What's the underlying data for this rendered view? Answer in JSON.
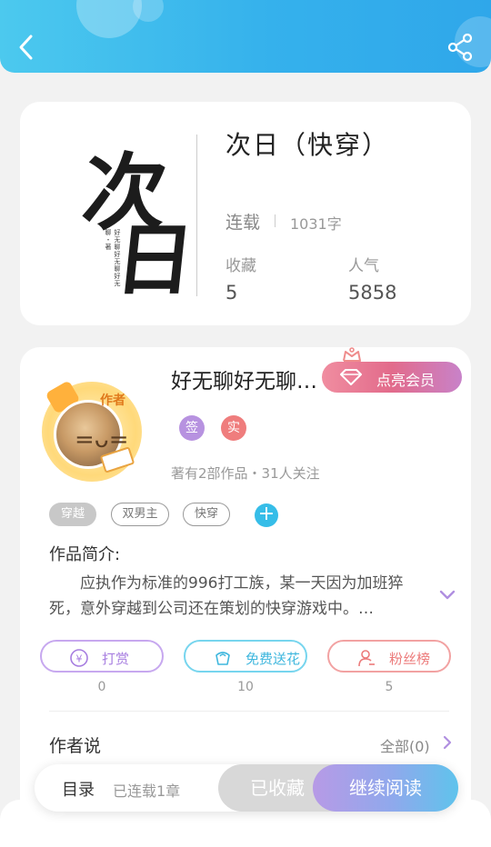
{
  "header": {
    "back_icon": "chevron-left-icon",
    "share_icon": "share-icon",
    "gradient": [
      "#4cc9ee",
      "#2fa7ea"
    ]
  },
  "book": {
    "title": "次日（快穿）",
    "cover": {
      "glyphs": [
        "次",
        "日"
      ],
      "vertical_text": "好无聊好无聊好无聊・著"
    },
    "status": "连载",
    "word_count": "1031字",
    "stats": [
      {
        "label": "收藏",
        "value": "5"
      },
      {
        "label": "人气",
        "value": "5858"
      }
    ]
  },
  "author": {
    "name": "好无聊好无聊…",
    "avatar_tag": "作者",
    "vip_button": "点亮会员",
    "badges": [
      "签",
      "实"
    ],
    "meta": "著有2部作品・31人关注",
    "tags": [
      "穿越",
      "双男主",
      "快穿"
    ],
    "add_tag_symbol": "+",
    "intro_label": "作品简介:",
    "intro_text": "应执作为标准的996打工族，某一天因为加班猝死，意外穿越到公司还在策划的快穿游戏中。…",
    "actions": [
      {
        "icon": "yen-icon",
        "label": "打赏",
        "count": "0"
      },
      {
        "icon": "flower-icon",
        "label": "免费送花",
        "count": "10"
      },
      {
        "icon": "fans-icon",
        "label": "粉丝榜",
        "count": "5"
      }
    ],
    "author_say_label": "作者说",
    "author_say_all": "全部(0)"
  },
  "bottom_bar": {
    "toc_label": "目录",
    "toc_count": "已连载1章",
    "favorite_label": "已收藏",
    "read_label": "继续阅读"
  }
}
